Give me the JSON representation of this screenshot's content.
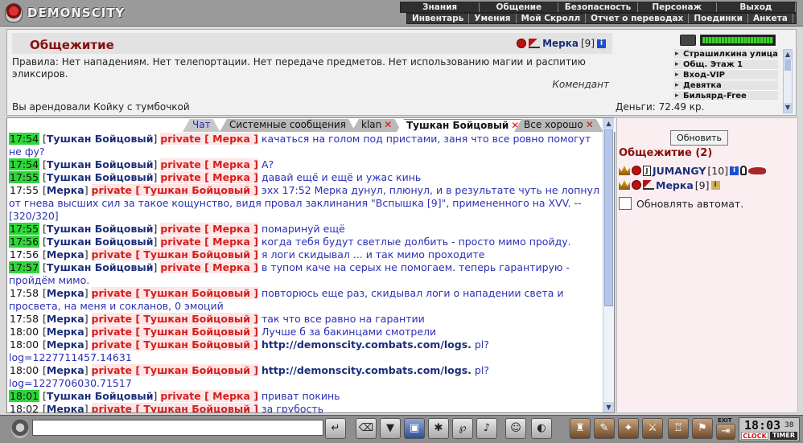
{
  "brand": "DEMONSCITY",
  "menu_top": [
    "Знания",
    "Общение",
    "Безопасность",
    "Персонаж",
    "Выход"
  ],
  "menu_sub": [
    "Инвентарь",
    "Умения",
    "Мой Скролл",
    "Отчет о переводах",
    "Поединки",
    "Анкета"
  ],
  "location": {
    "title": "Общежитие",
    "keeper_name": "Мерка",
    "keeper_level": "[9]",
    "rules": "Правила: Нет нападениям. Нет телепортации. Нет передаче предметов. Нет использованию магии и распитию эликсиров.",
    "signed": "Комендант",
    "rent": "Вы арендовали Койку с тумбочкой",
    "money": "Деньги: 72.49 кр."
  },
  "nav_locations": [
    "Страшилкина улица",
    "Общ. Этаж 1",
    "Вход-VIP",
    "Девятка",
    "Бильярд-Free"
  ],
  "tabs": [
    {
      "label": "Чат",
      "close": ""
    },
    {
      "label": "Системные сообщения",
      "close": ""
    },
    {
      "label": "klan",
      "close": "✕"
    },
    {
      "label": "Тушкан Бойцовый",
      "close": "✕"
    },
    {
      "label": "Все хорошо",
      "close": "✕"
    }
  ],
  "chat": [
    {
      "time": "17:54",
      "hl": true,
      "nick": "Тушкан Бойцовый",
      "to": "private [ Мерка ]",
      "text": "качаться на голом под пристами, заня что все ровно помогут не фу?"
    },
    {
      "time": "17:54",
      "hl": true,
      "nick": "Тушкан Бойцовый",
      "to": "private [ Мерка ]",
      "text": "А?"
    },
    {
      "time": "17:55",
      "hl": true,
      "nick": "Тушкан Бойцовый",
      "to": "private [ Мерка ]",
      "text": "давай ещё и ещё и ужас кинь"
    },
    {
      "time": "17:55",
      "hl": false,
      "nick": "Мерка",
      "to": "private [ Тушкан Бойцовый ]",
      "text": "эхх 17:52 Мерка дунул, плюнул, и в результате чуть не лопнул от гнева высших сил за такое кощунство, видя провал заклинания \"Вспышка [9]\", примененного на XVV. -- [320/320]"
    },
    {
      "time": "17:55",
      "hl": true,
      "nick": "Тушкан Бойцовый",
      "to": "private [ Мерка ]",
      "text": "помаринуй ещё"
    },
    {
      "time": "17:56",
      "hl": true,
      "nick": "Тушкан Бойцовый",
      "to": "private [ Мерка ]",
      "text": "когда тебя будут светлые долбить - просто мимо пройду."
    },
    {
      "time": "17:56",
      "hl": false,
      "nick": "Мерка",
      "to": "private [ Тушкан Бойцовый ]",
      "text": "я логи скидывал ... и так мимо проходите"
    },
    {
      "time": "17:57",
      "hl": true,
      "nick": "Тушкан Бойцовый",
      "to": "private [ Мерка ]",
      "text": "в тупом каче на серых не помогаем. теперь гарантирую - пройдём мимо."
    },
    {
      "time": "17:58",
      "hl": false,
      "nick": "Мерка",
      "to": "private [ Тушкан Бойцовый ]",
      "text": "повторюсь еще раз, скидывал логи о нападении света и просвета, на меня и сокланов, 0 эмоций"
    },
    {
      "time": "17:58",
      "hl": false,
      "nick": "Мерка",
      "to": "private [ Тушкан Бойцовый ]",
      "text": "так что все равно на гарантии"
    },
    {
      "time": "18:00",
      "hl": false,
      "nick": "Мерка",
      "to": "private [ Тушкан Бойцовый ]",
      "text": "Лучше б за бакинцами смотрели"
    },
    {
      "time": "18:00",
      "hl": false,
      "nick": "Мерка",
      "to": "private [ Тушкан Бойцовый ]",
      "link": "http://demonscity.combats.com/logs.",
      "text": "pl?log=1227711457.14631"
    },
    {
      "time": "18:00",
      "hl": false,
      "nick": "Мерка",
      "to": "private [ Тушкан Бойцовый ]",
      "link": "http://demonscity.combats.com/logs.",
      "text": "pl?log=1227706030.71517"
    },
    {
      "time": "18:01",
      "hl": true,
      "nick": "Тушкан Бойцовый",
      "to": "private [ Мерка ]",
      "text": "приват покинь"
    },
    {
      "time": "18:02",
      "hl": false,
      "nick": "Мерка",
      "to": "private [ Тушкан Бойцовый ]",
      "text": "за грубость"
    }
  ],
  "right": {
    "refresh": "Обновить",
    "room": "Общежитие (2)",
    "users": [
      {
        "name": "JUMANGY",
        "level": "[10]"
      },
      {
        "name": "Мерка",
        "level": "[9]"
      }
    ],
    "auto_refresh": "Обновлять автомат."
  },
  "bottom": {
    "exit": "EXIT",
    "clock": "18:03",
    "seconds": "38",
    "clock_lbl": "CLOCK",
    "timer_lbl": "TIMER"
  },
  "colors": {
    "private": "#d31f1f",
    "nick": "#1c2e7a",
    "msg": "#2b30b5",
    "time_hl": "#2fd63a",
    "room_title": "#8a0f0f"
  }
}
